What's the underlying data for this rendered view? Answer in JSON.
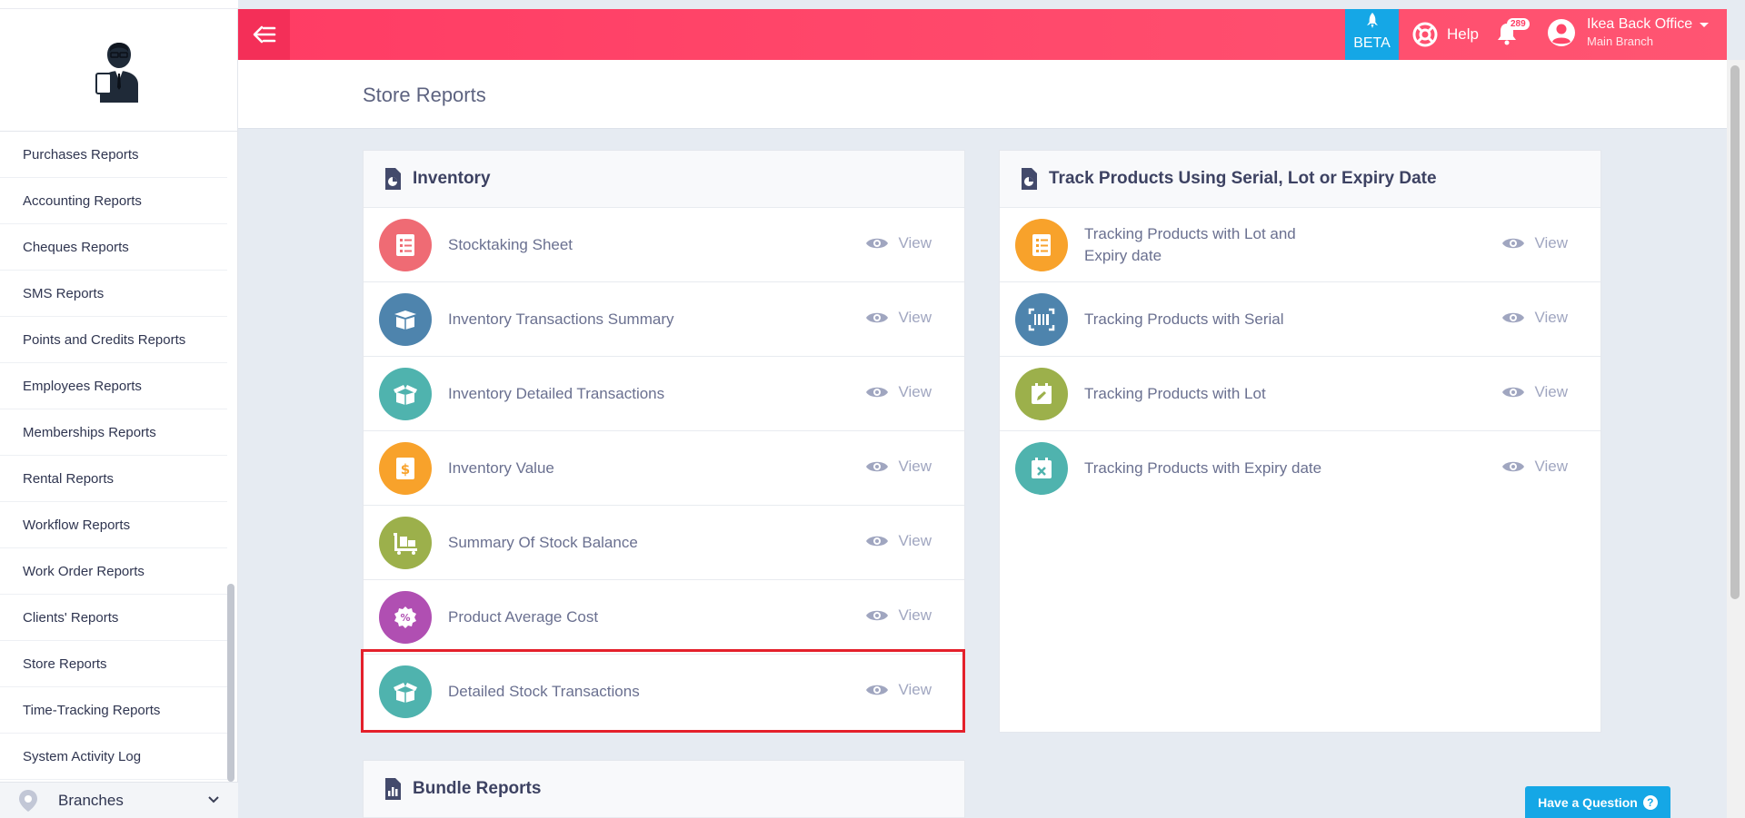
{
  "sidebar": {
    "items": [
      {
        "label": "Purchases Reports"
      },
      {
        "label": "Accounting Reports"
      },
      {
        "label": "Cheques Reports"
      },
      {
        "label": "SMS Reports"
      },
      {
        "label": "Points and Credits Reports"
      },
      {
        "label": "Employees Reports"
      },
      {
        "label": "Memberships Reports"
      },
      {
        "label": "Rental Reports"
      },
      {
        "label": "Workflow Reports"
      },
      {
        "label": "Work Order Reports"
      },
      {
        "label": "Clients' Reports"
      },
      {
        "label": "Store Reports"
      },
      {
        "label": "Time-Tracking Reports"
      },
      {
        "label": "System Activity Log"
      }
    ],
    "branches_label": "Branches"
  },
  "topbar": {
    "beta_label": "BETA",
    "help_label": "Help",
    "notification_count": "289",
    "user_name": "Ikea Back Office",
    "user_branch": "Main Branch"
  },
  "page": {
    "title": "Store Reports"
  },
  "inventory": {
    "title": "Inventory",
    "view_label": "View",
    "rows": [
      {
        "label": "Stocktaking Sheet",
        "color": "#ef6b74"
      },
      {
        "label": "Inventory Transactions Summary",
        "color": "#4e84ad"
      },
      {
        "label": "Inventory Detailed Transactions",
        "color": "#4fb3ae"
      },
      {
        "label": "Inventory Value",
        "color": "#f8a22b"
      },
      {
        "label": "Summary Of Stock Balance",
        "color": "#9cb04b"
      },
      {
        "label": "Product Average Cost",
        "color": "#b04fb2"
      },
      {
        "label": "Detailed Stock Transactions",
        "color": "#4fb3ae"
      }
    ]
  },
  "tracking": {
    "title": "Track Products Using Serial, Lot or Expiry Date",
    "view_label": "View",
    "rows": [
      {
        "label": "Tracking Products with Lot and Expiry date",
        "color": "#f8a22b"
      },
      {
        "label": "Tracking Products with Serial",
        "color": "#4e84ad"
      },
      {
        "label": "Tracking Products with Lot",
        "color": "#9cb04b"
      },
      {
        "label": "Tracking Products with Expiry date",
        "color": "#4fb3ae"
      }
    ]
  },
  "bundle": {
    "title": "Bundle Reports"
  },
  "question_button": {
    "label": "Have a Question",
    "icon_glyph": "?"
  }
}
